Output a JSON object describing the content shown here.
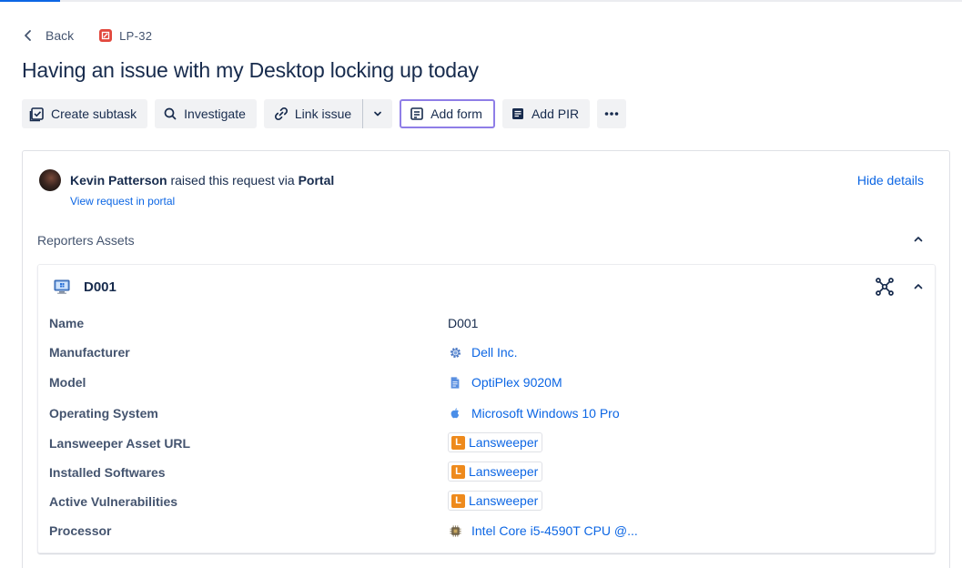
{
  "breadcrumb": {
    "back_label": "Back",
    "issue_key": "LP-32"
  },
  "issue": {
    "title": "Having an issue with my Desktop locking up today"
  },
  "toolbar": {
    "create_subtask": "Create subtask",
    "investigate": "Investigate",
    "link_issue": "Link issue",
    "add_form": "Add form",
    "add_pir": "Add PIR"
  },
  "request": {
    "reporter": "Kevin Patterson",
    "raised_text": " raised this request via ",
    "channel": "Portal",
    "view_portal": "View request in portal",
    "hide_details": "Hide details"
  },
  "reporters_assets": {
    "label": "Reporters Assets",
    "asset": {
      "name": "D001",
      "attributes": [
        {
          "label": "Name",
          "value": "D001",
          "type": "text"
        },
        {
          "label": "Manufacturer",
          "value": "Dell Inc.",
          "type": "link",
          "icon": "gear-icon"
        },
        {
          "label": "Model",
          "value": "OptiPlex 9020M",
          "type": "link",
          "icon": "document-icon"
        },
        {
          "label": "Operating System",
          "value": "Microsoft Windows 10 Pro",
          "type": "link",
          "icon": "apple-icon"
        },
        {
          "label": "Lansweeper Asset URL",
          "value": "Lansweeper",
          "type": "badge",
          "badge_letter": "L"
        },
        {
          "label": "Installed Softwares",
          "value": "Lansweeper",
          "type": "badge",
          "badge_letter": "L"
        },
        {
          "label": "Active Vulnerabilities",
          "value": "Lansweeper",
          "type": "badge",
          "badge_letter": "L"
        },
        {
          "label": "Processor",
          "value": "Intel Core i5-4590T CPU @...",
          "type": "link",
          "icon": "cpu-icon"
        }
      ]
    }
  },
  "colors": {
    "link": "#0c66e4",
    "badge_orange": "#ee8a1c",
    "key_red": "#e2483d",
    "outline_purple": "#8f7ee7"
  }
}
